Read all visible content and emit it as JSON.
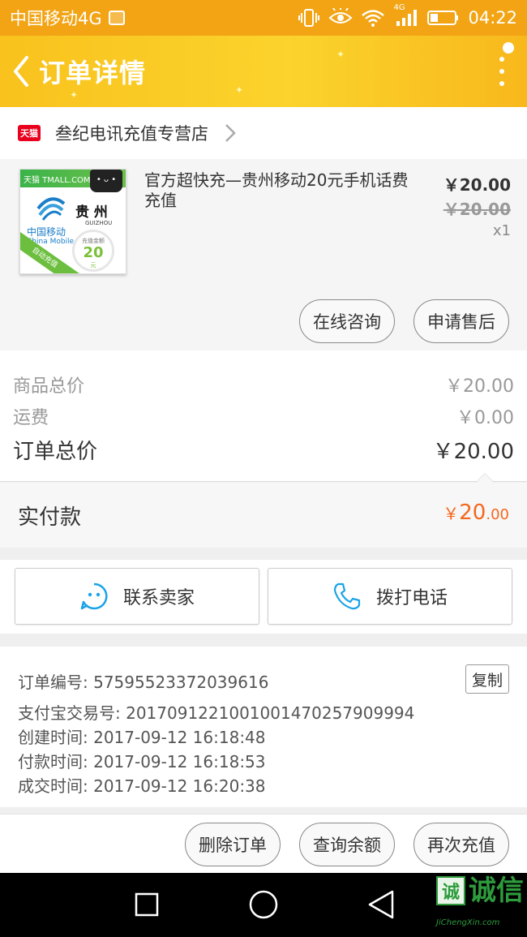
{
  "status_bar": {
    "carrier": "中国移动4G",
    "network": "4G",
    "time": "04:22"
  },
  "header": {
    "title": "订单详情"
  },
  "shop": {
    "badge": "天猫",
    "name": "叁纪电讯充值专营店"
  },
  "product": {
    "thumb": {
      "topbar": "天猫 TMALL.COM",
      "province": "贵 州",
      "province_en": "GUIZHOU",
      "brand_cn": "中国移动",
      "brand_en": "China Mobile",
      "amount_label": "充值金额",
      "amount": "20",
      "unit": "元",
      "ribbon": "自动充值"
    },
    "title": "官方超快充—贵州移动20元手机话费充值",
    "price": "￥20.00",
    "original_price": "￥20.00",
    "quantity": "x1",
    "buttons": [
      "在线咨询",
      "申请售后"
    ]
  },
  "summary": {
    "goods_total_label": "商品总价",
    "goods_total_value": "￥20.00",
    "shipping_label": "运费",
    "shipping_value": "￥0.00",
    "order_total_label": "订单总价",
    "order_total_value": "￥20.00"
  },
  "paid": {
    "label": "实付款",
    "currency": "￥",
    "integer": "20",
    "decimal": ".00"
  },
  "contact": {
    "seller_label": "联系卖家",
    "phone_label": "拨打电话"
  },
  "info": {
    "order_no": "订单编号: 57595523372039616",
    "alipay_no": "支付宝交易号: 2017091221001001470257909994",
    "created": "创建时间: 2017-09-12 16:18:48",
    "paid": "付款时间: 2017-09-12 16:18:53",
    "closed": "成交时间: 2017-09-12 16:20:38",
    "copy_label": "复制"
  },
  "actions": {
    "delete": "删除订单",
    "balance": "查询余额",
    "recharge": "再次充值"
  },
  "watermark": {
    "char": "诚",
    "text": "诚信",
    "url": "JiChengXin.com"
  },
  "colors": {
    "header": "#fbcf2a",
    "statusbar": "#f2a414",
    "accent": "#f4671e"
  }
}
